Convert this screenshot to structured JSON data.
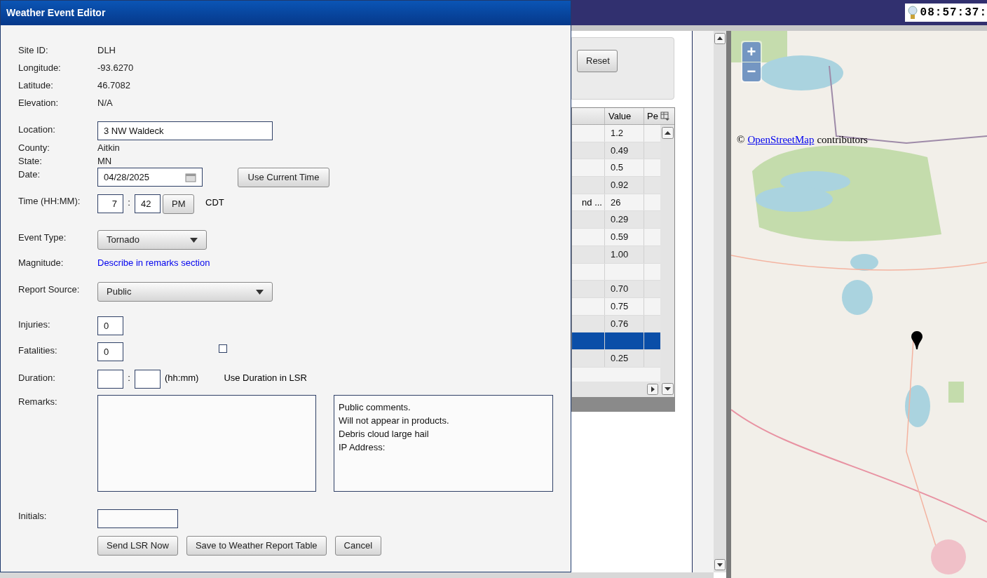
{
  "clock": "08:57:37:",
  "filter_panel": {
    "reset_button": "Reset"
  },
  "table": {
    "columns": [
      "Value",
      "Pe"
    ],
    "rows": [
      {
        "column_1": "",
        "value": "1.2",
        "selected": false
      },
      {
        "column_1": "",
        "value": "0.49",
        "selected": false
      },
      {
        "column_1": "",
        "value": "0.5",
        "selected": false
      },
      {
        "column_1": "",
        "value": "0.92",
        "selected": false
      },
      {
        "column_1": "nd ...",
        "value": "26",
        "selected": false
      },
      {
        "column_1": "",
        "value": "0.29",
        "selected": false
      },
      {
        "column_1": "",
        "value": "0.59",
        "selected": false
      },
      {
        "column_1": "",
        "value": "1.00",
        "selected": false
      },
      {
        "column_1": "",
        "value": "",
        "selected": false
      },
      {
        "column_1": "",
        "value": "0.70",
        "selected": false
      },
      {
        "column_1": "",
        "value": "0.75",
        "selected": false
      },
      {
        "column_1": "",
        "value": "0.76",
        "selected": false
      },
      {
        "column_1": "",
        "value": "",
        "selected": true
      },
      {
        "column_1": "",
        "value": "0.25",
        "selected": false
      }
    ]
  },
  "map": {
    "zoom_in": "+",
    "zoom_out": "−",
    "attribution_prefix": "©",
    "attribution_link": "OpenStreetMap",
    "attribution_suffix": "contributors"
  },
  "dialog": {
    "title": "Weather Event Editor",
    "info": [
      {
        "label": "Site ID:",
        "value": "DLH"
      },
      {
        "label": "Longitude:",
        "value": "-93.6270"
      },
      {
        "label": "Latitude:",
        "value": "46.7082"
      },
      {
        "label": "Elevation:",
        "value": "N/A"
      }
    ],
    "location": {
      "label": "Location:",
      "value": "3 NW Waldeck"
    },
    "county": {
      "label": "County:",
      "value": "Aitkin"
    },
    "state": {
      "label": "State:",
      "value": "MN"
    },
    "date": {
      "label": "Date:",
      "value": "04/28/2025"
    },
    "use_current_time_button": "Use Current Time",
    "time": {
      "label": "Time (HH:MM):",
      "hour": "7",
      "separator": ":",
      "minute": "42",
      "ampm": "PM",
      "zone": "CDT"
    },
    "event_type": {
      "label": "Event Type:",
      "value": "Tornado"
    },
    "magnitude": {
      "label": "Magnitude:",
      "value": "Describe in remarks section"
    },
    "report_source": {
      "label": "Report Source:",
      "value": "Public"
    },
    "injuries": {
      "label": "Injuries:",
      "value": "0"
    },
    "fatalities": {
      "label": "Fatalities:",
      "value": "0"
    },
    "use_duration": {
      "label": "Use Duration in LSR",
      "checked": false
    },
    "duration": {
      "label": "Duration:",
      "separator": ":",
      "unit": "(hh:mm)"
    },
    "remarks": {
      "label": "Remarks:",
      "public_comments": [
        "Public comments.",
        "Will not appear in products.",
        "Debris cloud large hail",
        "IP Address:"
      ]
    },
    "initials": {
      "label": "Initials:"
    },
    "buttons": [
      "Send LSR Now",
      "Save to Weather Report Table",
      "Cancel"
    ]
  }
}
